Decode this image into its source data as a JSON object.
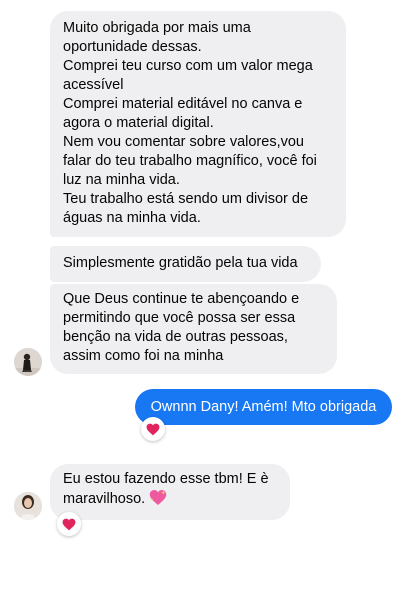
{
  "conversation": {
    "message1": {
      "lines": [
        "Muito obrigada por mais uma oportunidade dessas.",
        "Comprei teu curso com um valor mega acessível",
        "Comprei material editável no canva e agora o material digital.",
        "Nem vou comentar sobre valores,vou falar do teu trabalho magnífico, você foi luz na minha vida.",
        "Teu trabalho está sendo um divisor de águas na minha vida."
      ]
    },
    "message2": {
      "text": "Simplesmente gratidão pela tua vida"
    },
    "message3": {
      "text": "Que Deus continue te abençoando e permitindo que você possa ser essa benção na vida de outras pessoas, assim como foi na minha"
    },
    "sent_message": {
      "text": "Ownnn Dany! Amém! Mto obrigada",
      "reaction_icon": "red-heart"
    },
    "message4": {
      "text": "Eu estou fazendo esse tbm! E è maravilhoso.",
      "inline_icon": "sparkling-heart",
      "reaction_icon": "red-heart"
    }
  },
  "colors": {
    "received_bubble": "#efeff1",
    "sent_bubble": "#1877f2",
    "reaction_heart": "#e0245e"
  }
}
